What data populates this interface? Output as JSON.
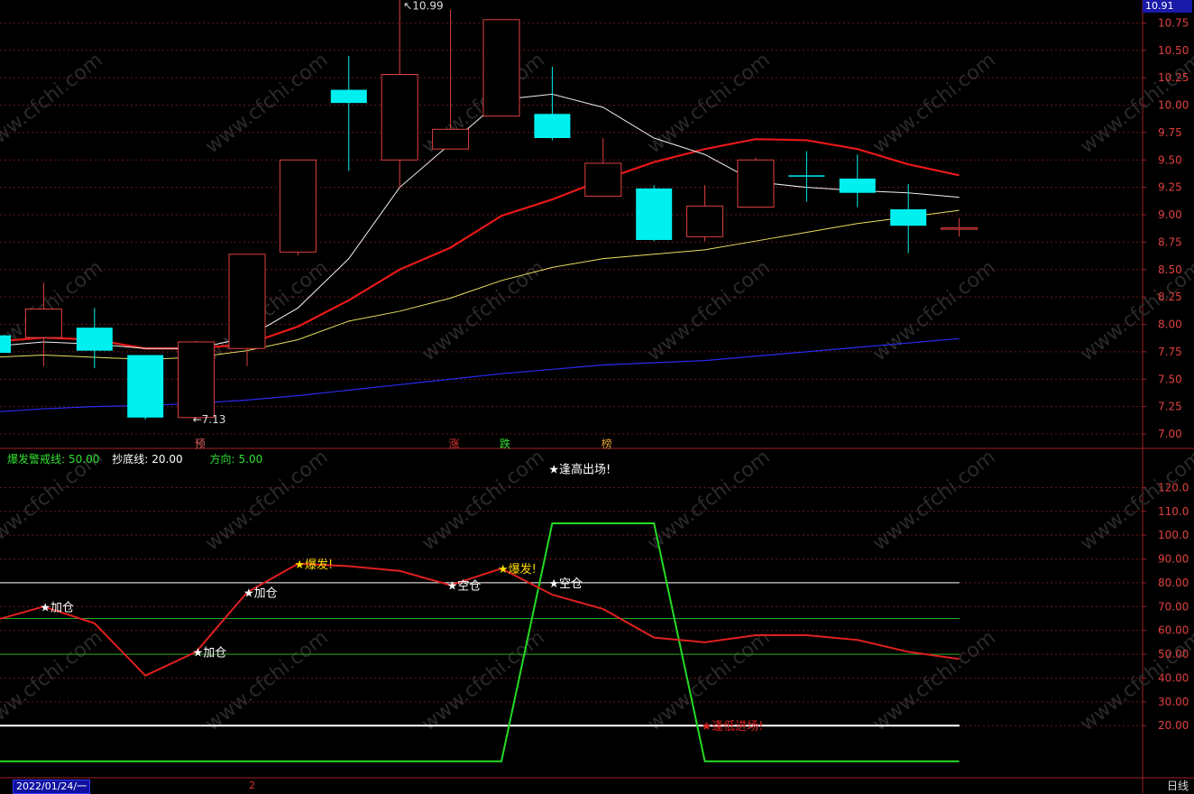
{
  "chart_data": [
    {
      "type": "candlestick",
      "ylim": [
        7.0,
        10.91
      ],
      "yticks": [
        "10.75",
        "10.50",
        "10.25",
        "10.00",
        "9.75",
        "9.50",
        "9.25",
        "9.00",
        "8.75",
        "8.50",
        "8.25",
        "8.00",
        "7.75",
        "7.50",
        "7.25",
        "7.00"
      ],
      "current_price": "10.91",
      "candles": [
        {
          "o": 7.9,
          "h": 8.02,
          "l": 7.65,
          "c": 7.74
        },
        {
          "o": 7.88,
          "h": 8.38,
          "l": 7.62,
          "c": 8.14
        },
        {
          "o": 7.97,
          "h": 8.15,
          "l": 7.6,
          "c": 7.76
        },
        {
          "o": 7.72,
          "h": 7.72,
          "l": 7.13,
          "c": 7.15
        },
        {
          "o": 7.15,
          "h": 7.85,
          "l": 7.13,
          "c": 7.84
        },
        {
          "o": 7.78,
          "h": 8.64,
          "l": 7.62,
          "c": 8.64
        },
        {
          "o": 8.66,
          "h": 9.5,
          "l": 8.63,
          "c": 9.5
        },
        {
          "o": 10.14,
          "h": 10.45,
          "l": 9.4,
          "c": 10.02
        },
        {
          "o": 9.5,
          "h": 10.99,
          "l": 9.25,
          "c": 10.28
        },
        {
          "o": 9.6,
          "h": 10.87,
          "l": 9.6,
          "c": 9.78
        },
        {
          "o": 9.9,
          "h": 10.78,
          "l": 9.9,
          "c": 10.78
        },
        {
          "o": 9.92,
          "h": 10.35,
          "l": 9.68,
          "c": 9.7
        },
        {
          "o": 9.17,
          "h": 9.7,
          "l": 9.17,
          "c": 9.47
        },
        {
          "o": 9.24,
          "h": 9.27,
          "l": 8.76,
          "c": 8.77
        },
        {
          "o": 8.8,
          "h": 9.27,
          "l": 8.76,
          "c": 9.08
        },
        {
          "o": 9.07,
          "h": 9.52,
          "l": 9.07,
          "c": 9.5
        },
        {
          "o": 9.36,
          "h": 9.58,
          "l": 9.12,
          "c": 9.35
        },
        {
          "o": 9.33,
          "h": 9.55,
          "l": 9.07,
          "c": 9.2
        },
        {
          "o": 9.05,
          "h": 9.28,
          "l": 8.65,
          "c": 8.9
        },
        {
          "o": 8.88,
          "h": 8.97,
          "l": 8.8,
          "c": 8.88
        }
      ],
      "ma_white": [
        7.8,
        7.84,
        7.82,
        7.78,
        7.78,
        7.88,
        8.15,
        8.6,
        9.25,
        9.65,
        10.05,
        10.1,
        9.98,
        9.7,
        9.55,
        9.3,
        9.25,
        9.22,
        9.2,
        9.16
      ],
      "ma_red": [
        7.84,
        7.88,
        7.86,
        7.78,
        7.78,
        7.82,
        7.98,
        8.22,
        8.5,
        8.7,
        8.99,
        9.14,
        9.32,
        9.48,
        9.6,
        9.69,
        9.68,
        9.6,
        9.46,
        9.36
      ],
      "ma_yellow": [
        7.7,
        7.72,
        7.7,
        7.68,
        7.7,
        7.76,
        7.86,
        8.03,
        8.12,
        8.24,
        8.4,
        8.52,
        8.6,
        8.64,
        8.68,
        8.76,
        8.84,
        8.92,
        8.98,
        9.04
      ],
      "ma_blue": [
        7.2,
        7.23,
        7.25,
        7.26,
        7.28,
        7.31,
        7.35,
        7.4,
        7.45,
        7.5,
        7.55,
        7.59,
        7.63,
        7.65,
        7.67,
        7.71,
        7.75,
        7.79,
        7.83,
        7.87
      ],
      "high_label": "10.99",
      "low_label": "7.13",
      "markers": [
        {
          "index": 4,
          "text": "预",
          "color": "#e06060"
        },
        {
          "index": 9,
          "text": "涨",
          "color": "#e03030"
        },
        {
          "index": 10,
          "text": "跌",
          "color": "#30e030"
        },
        {
          "index": 12,
          "text": "榜",
          "color": "#e0a030"
        }
      ]
    },
    {
      "type": "line",
      "ylim": [
        0,
        130
      ],
      "yticks": [
        "120.0",
        "110.0",
        "100.0",
        "90.00",
        "80.00",
        "70.00",
        "60.00",
        "50.00",
        "40.00",
        "30.00",
        "20.00"
      ],
      "hlines": [
        {
          "y": 80,
          "color": "#ffffff",
          "width": 1
        },
        {
          "y": 65,
          "color": "#22aa22",
          "width": 1
        },
        {
          "y": 50,
          "color": "#22aa22",
          "width": 1
        },
        {
          "y": 20,
          "color": "#ffffff",
          "width": 2
        }
      ],
      "series": [
        {
          "color": "#e02020",
          "values": [
            64,
            70,
            63,
            41,
            51,
            76,
            88,
            87,
            85,
            79,
            86,
            75,
            69,
            57,
            55,
            58,
            58,
            56,
            51,
            48
          ]
        },
        {
          "color": "#22dd22",
          "values": [
            5,
            5,
            5,
            5,
            5,
            5,
            5,
            5,
            5,
            5,
            5,
            105,
            105,
            105,
            5,
            5,
            5,
            5,
            5,
            5
          ]
        }
      ],
      "annotations": [
        {
          "index": 1,
          "y": 70,
          "text": "★加仓",
          "color": "#ffffff"
        },
        {
          "index": 4,
          "y": 51,
          "text": "★加仓",
          "color": "#ffffff"
        },
        {
          "index": 5,
          "y": 76,
          "text": "★加仓",
          "color": "#ffffff"
        },
        {
          "index": 6,
          "y": 88,
          "text": "★爆发!",
          "color": "#ffdd00"
        },
        {
          "index": 9,
          "y": 79,
          "text": "★空仓",
          "color": "#ffffff"
        },
        {
          "index": 10,
          "y": 86,
          "text": "★爆发!",
          "color": "#ffdd00"
        },
        {
          "index": 11,
          "y": 80,
          "text": "★空仓",
          "color": "#ffffff"
        },
        {
          "index": 14,
          "y": 20,
          "text": "★逢低进场!",
          "color": "#e02020"
        },
        {
          "index": 11,
          "y": 128,
          "text": "★逢高出场!",
          "color": "#ffffff"
        }
      ]
    }
  ],
  "legend": {
    "alert_label": "爆发警戒线:",
    "alert_value": "50.00",
    "bottom_label": "抄底线:",
    "bottom_value": "20.00",
    "dir_label": "方向:",
    "dir_value": "5.00"
  },
  "footer": {
    "date": "2022/01/24/一",
    "tab": "2",
    "period": "日线"
  },
  "watermark": "www.cfchi.com",
  "colors": {
    "up": "#e04040",
    "down": "#00f0f0",
    "grid": "#6a1a1a",
    "axis": "#a02020"
  }
}
